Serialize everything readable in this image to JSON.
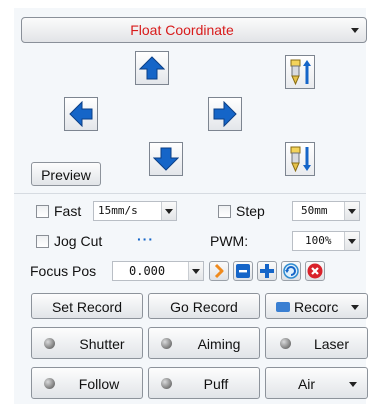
{
  "coordinate_mode": {
    "selected": "Float Coordinate"
  },
  "jog": {
    "up_icon": "arrow-up-icon",
    "down_icon": "arrow-down-icon",
    "left_icon": "arrow-left-icon",
    "right_icon": "arrow-right-icon",
    "z_up_icon": "z-axis-up-icon",
    "z_down_icon": "z-axis-down-icon"
  },
  "preview_label": "Preview",
  "fast": {
    "label": "Fast",
    "speed": "15mm/s",
    "checked": false
  },
  "step": {
    "label": "Step",
    "value": "50mm",
    "checked": false
  },
  "jog_cut": {
    "label": "Jog Cut",
    "ellipsis": "···",
    "checked": false
  },
  "pwm": {
    "label": "PWM:",
    "value": "100%"
  },
  "focus": {
    "label": "Focus Pos",
    "value": "0.000"
  },
  "focus_tools": [
    "play-icon",
    "minus-icon",
    "plus-icon",
    "refresh-icon",
    "close-icon"
  ],
  "record": {
    "set": "Set Record",
    "go": "Go Record",
    "menu": "Recorc"
  },
  "toggles": {
    "shutter": "Shutter",
    "aiming": "Aiming",
    "laser": "Laser",
    "follow": "Follow",
    "puff": "Puff",
    "air": "Air"
  },
  "colors": {
    "accent_blue": "#1565c8",
    "title_red": "#d81b1b",
    "orange": "#f08a1c",
    "danger": "#d9212a"
  }
}
